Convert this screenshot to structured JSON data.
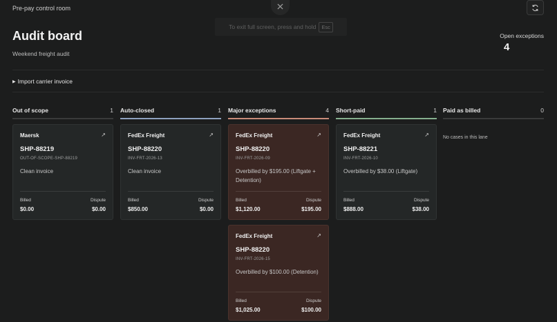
{
  "window": {
    "app_title": "Pre-pay control room",
    "fullscreen_toast": {
      "text": "To exit full screen, press and hold",
      "key": "Esc"
    }
  },
  "header": {
    "title": "Audit board",
    "subtitle": "Weekend freight audit",
    "open_exceptions_label": "Open exceptions",
    "open_exceptions_count": "4"
  },
  "import": {
    "label": "Import carrier invoice"
  },
  "icons": {
    "close": "close-icon",
    "refresh": "refresh-icon",
    "open": "arrow-up-right-icon",
    "disclosure": "triangle-right-icon"
  },
  "colors": {
    "background": "#1c1d1d",
    "card": "#242727",
    "exception_card": "#3b2723",
    "lane_out_of_scope": "#3a3b3b",
    "lane_auto_closed": "#8fa2bf",
    "lane_major_exceptions": "#c98c7a",
    "lane_short_paid": "#86b08f",
    "lane_paid_as_billed": "#3a3b3b"
  },
  "lanes": [
    {
      "name": "Out of scope",
      "count": "1",
      "cards": [
        {
          "carrier": "Maersk",
          "shipment": "SHP-88219",
          "invoice": "OUT-OF-SCOPE-SHP-88219",
          "note": "Clean invoice",
          "billed_label": "Billed",
          "billed": "$0.00",
          "dispute_label": "Dispute",
          "dispute": "$0.00"
        }
      ]
    },
    {
      "name": "Auto-closed",
      "count": "1",
      "cards": [
        {
          "carrier": "FedEx Freight",
          "shipment": "SHP-88220",
          "invoice": "INV-FRT-2026-13",
          "note": "Clean invoice",
          "billed_label": "Billed",
          "billed": "$850.00",
          "dispute_label": "Dispute",
          "dispute": "$0.00"
        }
      ]
    },
    {
      "name": "Major exceptions",
      "count": "4",
      "cards": [
        {
          "carrier": "FedEx Freight",
          "shipment": "SHP-88220",
          "invoice": "INV-FRT-2026-09",
          "note": "Overbilled by $195.00 (Liftgate + Detention)",
          "billed_label": "Billed",
          "billed": "$1,120.00",
          "dispute_label": "Dispute",
          "dispute": "$195.00"
        },
        {
          "carrier": "FedEx Freight",
          "shipment": "SHP-88220",
          "invoice": "INV-FRT-2026-15",
          "note": "Overbilled by $100.00 (Detention)",
          "billed_label": "Billed",
          "billed": "$1,025.00",
          "dispute_label": "Dispute",
          "dispute": "$100.00"
        }
      ]
    },
    {
      "name": "Short-paid",
      "count": "1",
      "cards": [
        {
          "carrier": "FedEx Freight",
          "shipment": "SHP-88221",
          "invoice": "INV-FRT-2026-10",
          "note": "Overbilled by $38.00 (Liftgate)",
          "billed_label": "Billed",
          "billed": "$888.00",
          "dispute_label": "Dispute",
          "dispute": "$38.00"
        }
      ]
    },
    {
      "name": "Paid as billed",
      "count": "0",
      "empty_text": "No cases in this lane",
      "cards": []
    }
  ]
}
